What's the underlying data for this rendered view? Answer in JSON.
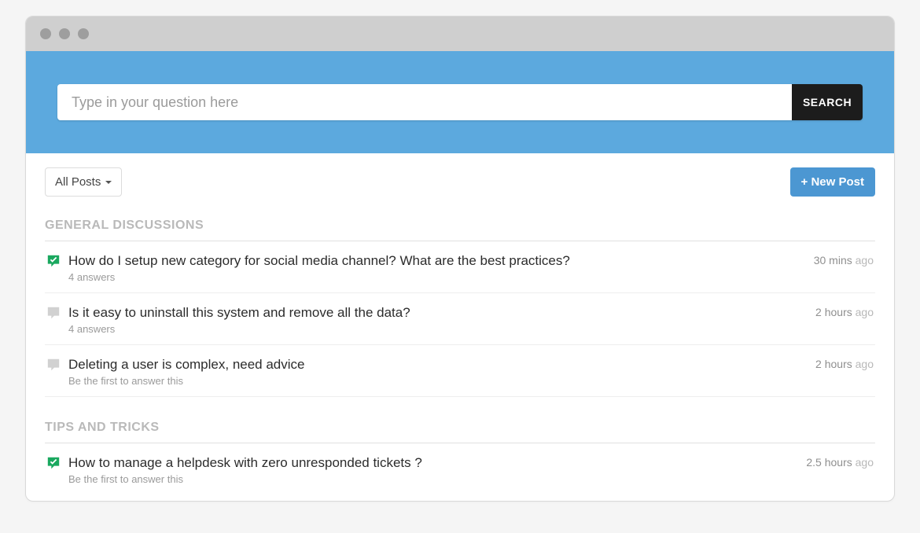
{
  "search": {
    "placeholder": "Type in your question here",
    "button": "SEARCH"
  },
  "toolbar": {
    "filter": "All Posts",
    "new_post": "+ New Post"
  },
  "time_unit": "ago",
  "sections": [
    {
      "title": "GENERAL DISCUSSIONS",
      "posts": [
        {
          "answered": true,
          "title": "How do I setup new category for social media channel? What are the best practices?",
          "sub": "4 answers",
          "time": "30 mins"
        },
        {
          "answered": false,
          "title": "Is it easy to uninstall this system and remove all the data?",
          "sub": "4 answers",
          "time": "2 hours"
        },
        {
          "answered": false,
          "title": "Deleting a user is complex, need advice",
          "sub": "Be the first to answer this",
          "time": "2 hours"
        }
      ]
    },
    {
      "title": "TIPS AND TRICKS",
      "posts": [
        {
          "answered": true,
          "title": "How to manage a helpdesk with zero unresponded tickets ?",
          "sub": "Be the first to answer this",
          "time": "2.5 hours"
        }
      ]
    }
  ]
}
